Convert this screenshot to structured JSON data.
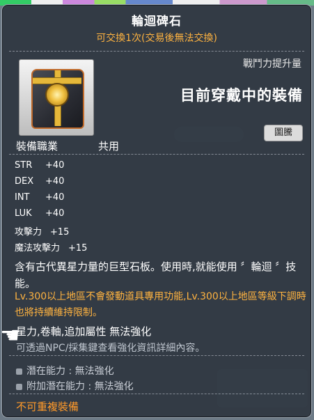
{
  "item": {
    "name": "輪迴碑石",
    "trade_note": "可交換1次(交易後無法交換)"
  },
  "power": {
    "label": "戰鬥力提升量",
    "status": "目前穿戴中的裝備",
    "button": "圖騰"
  },
  "job": {
    "label": "裝備職業",
    "value": "共用"
  },
  "stats": [
    {
      "name": "STR",
      "value": "+40"
    },
    {
      "name": "DEX",
      "value": "+40"
    },
    {
      "name": "INT",
      "value": "+40"
    },
    {
      "name": "LUK",
      "value": "+40"
    },
    {
      "name": "攻擊力",
      "value": "+15"
    },
    {
      "name": "魔法攻擊力",
      "value": "+15"
    }
  ],
  "description": "含有古代異星力量的巨型石板。使用時,就能使用 〞輪迴 〞技能。",
  "restriction_note": "Lv.300以上地區不會發動道具專用功能,Lv.300以上地區等級下調時也將持續維持限制。",
  "warnings": {
    "line1": "星力,卷軸,追加屬性 無法強化",
    "line2": "可透過NPC/採集鍵查看強化資訊詳細內容。"
  },
  "potential": {
    "main": "潛在能力 : 無法強化",
    "additional": "附加潛在能力 : 無法強化"
  },
  "footer": "不可重複裝備",
  "colors": {
    "accent": "#ffb340",
    "footer": "#ff9a2a"
  },
  "icons": {
    "item": "stone-tablet-icon",
    "cursor": "hand-cursor-icon"
  }
}
